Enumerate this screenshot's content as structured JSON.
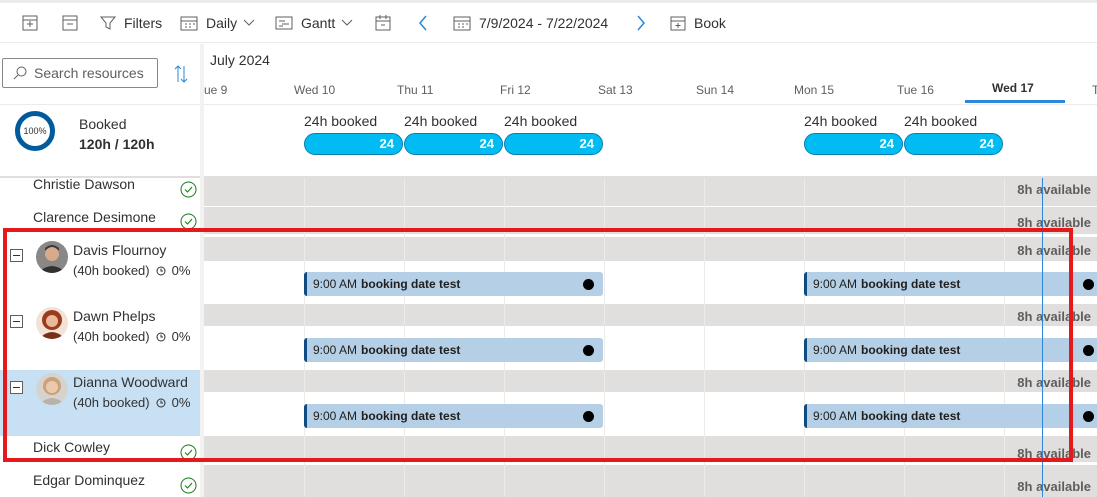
{
  "toolbar": {
    "expand_all_icon": "expand-icon",
    "collapse_all_icon": "collapse-icon",
    "filters_label": "Filters",
    "view_label": "Daily",
    "mode_label": "Gantt",
    "date_range": "7/9/2024 - 7/22/2024",
    "book_label": "Book"
  },
  "search": {
    "placeholder": "Search resources"
  },
  "summary": {
    "percent": "100%",
    "label": "Booked",
    "value": "120h / 120h"
  },
  "header": {
    "month": "July 2024",
    "days": [
      "ue 9",
      "Wed 10",
      "Thu 11",
      "Fri 12",
      "Sat 13",
      "Sun 14",
      "Mon 15",
      "Tue 16",
      "Wed 17",
      "T"
    ],
    "selected_day": "Wed 17"
  },
  "booked_summary": [
    {
      "day": "Wed 10",
      "text": "24h booked",
      "pill": "24"
    },
    {
      "day": "Thu 11",
      "text": "24h booked",
      "pill": "24"
    },
    {
      "day": "Fri 12",
      "text": "24h booked",
      "pill": "24"
    },
    {
      "day": "Mon 15",
      "text": "24h booked",
      "pill": "24"
    },
    {
      "day": "Tue 16",
      "text": "24h booked",
      "pill": "24"
    }
  ],
  "availability_text": "8h available",
  "resources": [
    {
      "name": "Christie Dawson",
      "expandable": false
    },
    {
      "name": "Clarence Desimone",
      "expandable": false
    },
    {
      "name": "Davis Flournoy",
      "sub": "(40h booked)",
      "util": "0%",
      "expandable": true,
      "selected": false
    },
    {
      "name": "Dawn Phelps",
      "sub": "(40h booked)",
      "util": "0%",
      "expandable": true,
      "selected": false
    },
    {
      "name": "Dianna Woodward",
      "sub": "(40h booked)",
      "util": "0%",
      "expandable": true,
      "selected": true
    },
    {
      "name": "Dick Cowley",
      "expandable": false
    },
    {
      "name": "Edgar Dominquez",
      "expandable": false
    }
  ],
  "booking": {
    "time": "9:00 AM",
    "title": "booking date test"
  },
  "colors": {
    "accent": "#2b88d8",
    "pill": "#00bcf2",
    "booking": "#b4cfe6",
    "highlight": "#e3191b"
  }
}
